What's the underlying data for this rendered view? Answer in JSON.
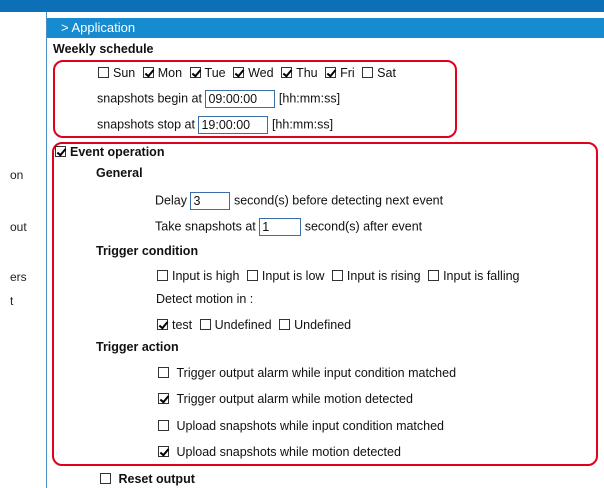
{
  "header": {
    "section_title": "> Application"
  },
  "left_nav": {
    "items": [
      "on",
      "out",
      "ers",
      "t"
    ]
  },
  "weekly_schedule": {
    "heading": "Weekly schedule",
    "days": [
      {
        "label": "Sun",
        "checked": false
      },
      {
        "label": "Mon",
        "checked": true
      },
      {
        "label": "Tue",
        "checked": true
      },
      {
        "label": "Wed",
        "checked": true
      },
      {
        "label": "Thu",
        "checked": true
      },
      {
        "label": "Fri",
        "checked": true
      },
      {
        "label": "Sat",
        "checked": false
      }
    ],
    "begin_label": "snapshots begin at",
    "begin_value": "09:00:00",
    "stop_label": "snapshots stop at",
    "stop_value": "19:00:00",
    "time_format": "[hh:mm:ss]"
  },
  "event_operation": {
    "label": "Event operation",
    "checked": true,
    "general": {
      "heading": "General",
      "delay_label": "Delay",
      "delay_value": "3",
      "delay_suffix": "second(s) before detecting next event",
      "snap_label": "Take snapshots at",
      "snap_value": "1",
      "snap_suffix": "second(s) after event"
    },
    "trigger_condition": {
      "heading": "Trigger condition",
      "inputs": [
        {
          "label": "Input is high",
          "checked": false
        },
        {
          "label": "Input is low",
          "checked": false
        },
        {
          "label": "Input is rising",
          "checked": false
        },
        {
          "label": "Input is falling",
          "checked": false
        }
      ],
      "motion_label": "Detect motion in :",
      "motion_windows": [
        {
          "label": "test",
          "checked": true
        },
        {
          "label": "Undefined",
          "checked": false
        },
        {
          "label": "Undefined",
          "checked": false
        }
      ]
    },
    "trigger_action": {
      "heading": "Trigger action",
      "actions": [
        {
          "label": "Trigger output alarm while input condition matched",
          "checked": false
        },
        {
          "label": "Trigger output alarm while motion detected",
          "checked": true
        },
        {
          "label": "Upload snapshots while input condition matched",
          "checked": false
        },
        {
          "label": "Upload snapshots while motion detected",
          "checked": true
        }
      ]
    }
  },
  "reset_output": {
    "label": "Reset output",
    "checked": false
  },
  "colors": {
    "header_blue": "#168bd0",
    "topbar_blue": "#0d6fb8",
    "highlight_red": "#e0001b"
  }
}
